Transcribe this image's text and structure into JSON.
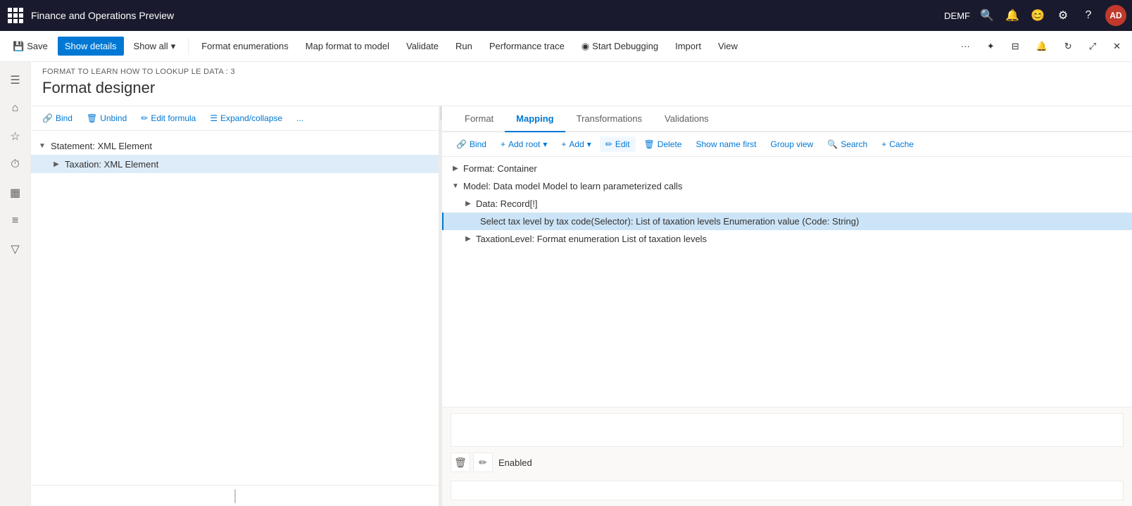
{
  "titleBar": {
    "appName": "Finance and Operations Preview",
    "user": "DEMF",
    "avatarText": "AD"
  },
  "commandBar": {
    "saveLabel": "Save",
    "showDetailsLabel": "Show details",
    "showAllLabel": "Show all",
    "formatEnumerationsLabel": "Format enumerations",
    "mapFormatToModelLabel": "Map format to model",
    "validateLabel": "Validate",
    "runLabel": "Run",
    "performanceTraceLabel": "Performance trace",
    "startDebuggingLabel": "Start Debugging",
    "importLabel": "Import",
    "viewLabel": "View"
  },
  "pageHeader": {
    "breadcrumb": "FORMAT TO LEARN HOW TO LOOKUP LE DATA : 3",
    "title": "Format designer"
  },
  "leftPanel": {
    "toolbar": {
      "bindLabel": "Bind",
      "unbindLabel": "Unbind",
      "editFormulaLabel": "Edit formula",
      "expandCollapseLabel": "Expand/collapse",
      "moreLabel": "..."
    },
    "treeNodes": [
      {
        "id": "statement",
        "label": "Statement: XML Element",
        "level": 0,
        "expanded": true,
        "selected": false,
        "hasChildren": true
      },
      {
        "id": "taxation",
        "label": "Taxation: XML Element",
        "level": 1,
        "expanded": false,
        "selected": true,
        "hasChildren": true
      }
    ]
  },
  "rightPanel": {
    "tabs": [
      {
        "id": "format",
        "label": "Format",
        "active": false
      },
      {
        "id": "mapping",
        "label": "Mapping",
        "active": true
      },
      {
        "id": "transformations",
        "label": "Transformations",
        "active": false
      },
      {
        "id": "validations",
        "label": "Validations",
        "active": false
      }
    ],
    "mappingToolbar": {
      "bindLabel": "Bind",
      "addRootLabel": "Add root",
      "addLabel": "Add",
      "editLabel": "Edit",
      "deleteLabel": "Delete",
      "showNameFirstLabel": "Show name first",
      "groupViewLabel": "Group view",
      "searchLabel": "Search",
      "cacheLabel": "Cache"
    },
    "treeNodes": [
      {
        "id": "format-container",
        "label": "Format: Container",
        "level": 0,
        "expanded": false,
        "highlighted": false
      },
      {
        "id": "model",
        "label": "Model: Data model Model to learn parameterized calls",
        "level": 0,
        "expanded": true,
        "highlighted": false
      },
      {
        "id": "data-record",
        "label": "Data: Record[!]",
        "level": 1,
        "expanded": false,
        "highlighted": false
      },
      {
        "id": "select-tax",
        "label": "Select tax level by tax code(Selector): List of taxation levels Enumeration value (Code: String)",
        "level": 2,
        "expanded": false,
        "highlighted": true
      },
      {
        "id": "taxation-level",
        "label": "TaxationLevel: Format enumeration List of taxation levels",
        "level": 1,
        "expanded": false,
        "highlighted": false
      }
    ]
  },
  "formulaArea": {
    "enabledLabel": "Enabled"
  }
}
